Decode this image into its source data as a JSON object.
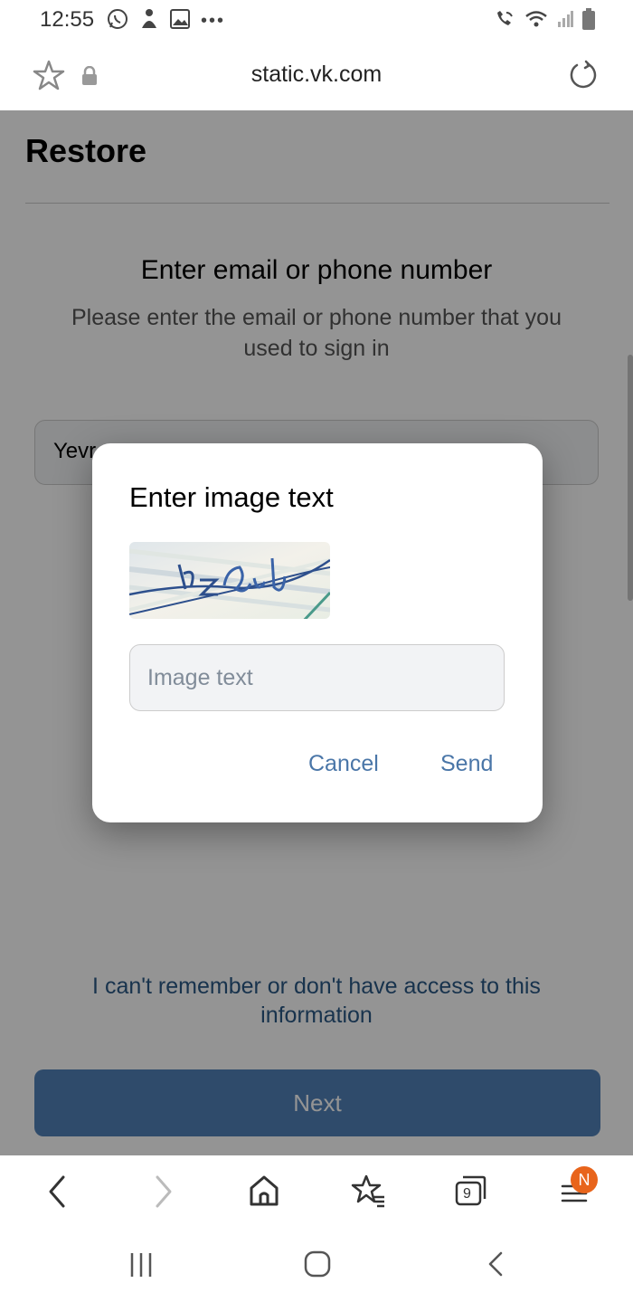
{
  "status_bar": {
    "time": "12:55"
  },
  "browser": {
    "url": "static.vk.com",
    "tab_count": "9",
    "menu_badge": "N"
  },
  "page": {
    "title": "Restore",
    "heading": "Enter email or phone number",
    "subtext": "Please enter the email or phone number that you used to sign in",
    "field_value": "Yevr",
    "help_link": "I can't remember or don't have access to this information",
    "next_label": "Next"
  },
  "dialog": {
    "title": "Enter image text",
    "input_placeholder": "Image text",
    "cancel_label": "Cancel",
    "send_label": "Send"
  },
  "colors": {
    "accent": "#4a76a8",
    "button": "#5181b8",
    "link": "#2a5885"
  },
  "icons": [
    "whatsapp-icon",
    "notification-icon",
    "image-icon",
    "more-icon",
    "wifi-call-icon",
    "wifi-icon",
    "signal-icon",
    "battery-icon",
    "bookmark-star-icon",
    "lock-icon",
    "reload-icon",
    "back-icon",
    "forward-icon",
    "home-icon",
    "bookmarks-icon",
    "tabs-icon",
    "menu-icon",
    "recent-apps-icon",
    "home-button-icon",
    "system-back-icon"
  ]
}
